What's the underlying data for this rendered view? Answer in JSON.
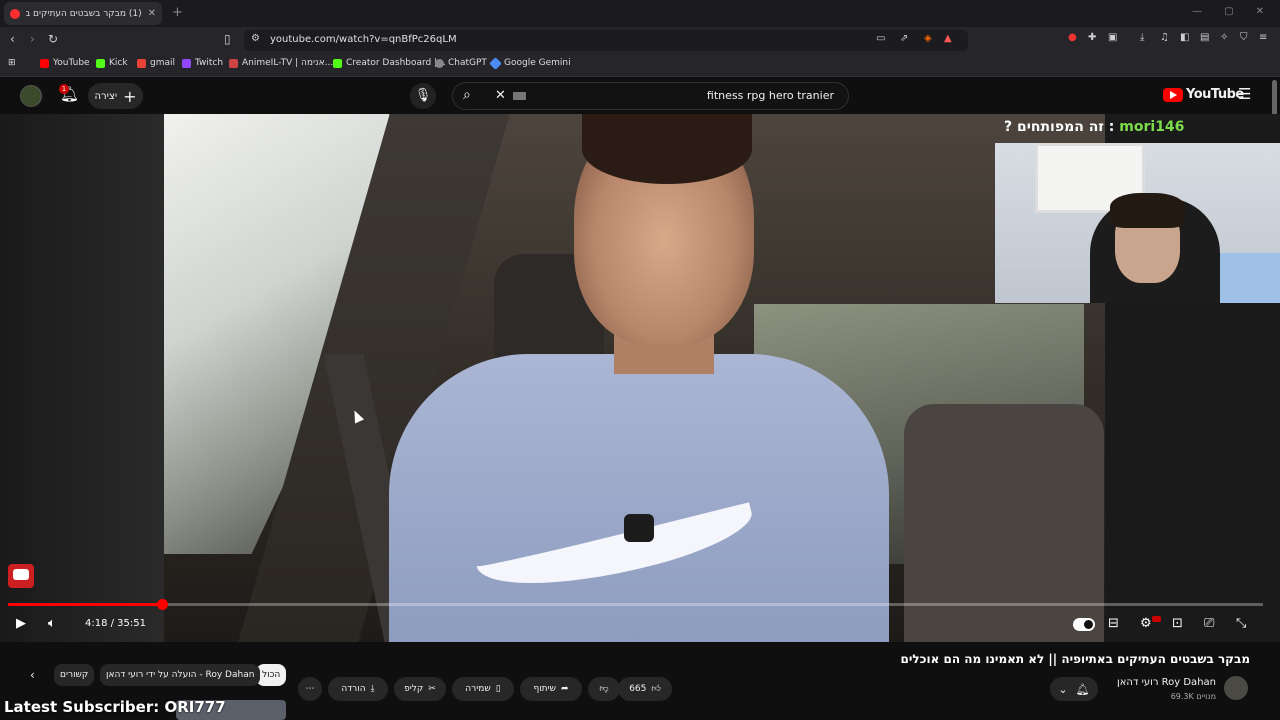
{
  "browser": {
    "tab_title": "(1) מבקר בשבטים העתיקים באת",
    "new_tab": "+",
    "url": "youtube.com/watch?v=qnBfPc26qLM",
    "bookmarks": [
      {
        "label": "YouTube",
        "color": "#ff0000"
      },
      {
        "label": "Kick",
        "color": "#53fc18"
      },
      {
        "label": "gmail",
        "color": "#ea4335"
      },
      {
        "label": "Twitch",
        "color": "#9146ff"
      },
      {
        "label": "AnimeIL-TV | אנימה...",
        "color": "#c44"
      },
      {
        "label": "Creator Dashboard |...",
        "color": "#53fc18"
      },
      {
        "label": "ChatGPT",
        "color": "#888888"
      },
      {
        "label": "Google Gemini",
        "color": "#4b8bf5"
      }
    ]
  },
  "youtube": {
    "create_label": "יצירה",
    "notification_count": "1",
    "search_query": "fitness rpg hero tranier",
    "logo_text": "YouTube"
  },
  "player": {
    "overlay_question": "? זה המפותחים : ",
    "overlay_name": "mori146",
    "time": "4:18 / 35:51",
    "progress_fraction": 0.123
  },
  "video": {
    "title": "מבקר בשבטים העתיקים באתיופיה || לא תאמינו מה הם אוכלים",
    "channel_name": "רועי דהאן Roy Dahan",
    "subscribers": "69.3K מנויים",
    "likes": "665",
    "share_label": "שיתוף",
    "save_label": "שמירה",
    "clip_label": "קליפ",
    "download_label": "הורדה"
  },
  "chips": {
    "all": "הכול",
    "uploaded_by": "הועלה על ידי רועי דהאן - Roy Dahan",
    "related": "קשורים"
  },
  "stream_overlay": {
    "latest_subscriber": "Latest Subscriber: ORI777"
  }
}
